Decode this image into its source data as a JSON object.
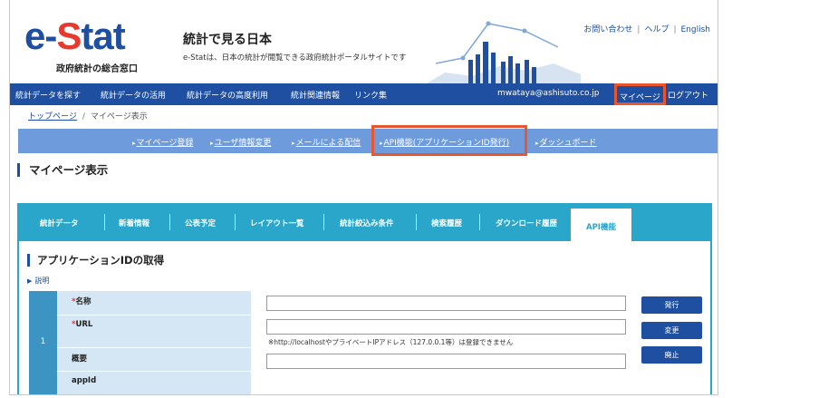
{
  "header": {
    "logo": {
      "e": "e",
      "dash": "-",
      "S": "S",
      "tat": "tat"
    },
    "logo_sub": "政府統計の総合窓口",
    "title": "統計で見る日本",
    "desc": "e-Statは、日本の統計が閲覧できる政府統計ポータルサイトです",
    "links": [
      "お問い合わせ",
      "ヘルプ",
      "English"
    ],
    "link_sep": "|"
  },
  "nav": {
    "items": [
      "統計データを探す",
      "統計データの活用",
      "統計データの高度利用",
      "統計関連情報",
      "リンク集"
    ],
    "user": "mwataya@ashisuto.co.jp",
    "mypage": "マイページ",
    "logout": "ログアウト"
  },
  "breadcrumb": {
    "home": "トップページ",
    "sep": "/",
    "current": "マイページ表示"
  },
  "submenu": [
    "マイページ登録",
    "ユーザ情報変更",
    "メールによる配信",
    "API機能(アプリケーションID発行)",
    "ダッシュボード"
  ],
  "page_title": "マイページ表示",
  "tabs": [
    "統計データ",
    "新着情報",
    "公表予定",
    "レイアウト一覧",
    "統計絞込み条件",
    "検索履歴",
    "ダウンロード履歴"
  ],
  "active_tab": "API機能",
  "section": {
    "title": "アプリケーションIDの取得",
    "explain": "説明"
  },
  "form": {
    "row_number": "1",
    "required_mark": "*",
    "fields": {
      "name": {
        "label": "名称",
        "value": ""
      },
      "url": {
        "label": "URL",
        "value": "",
        "note": "※http://localhostやプライベートIPアドレス（127.0.0.1等）は登録できません"
      },
      "summary": {
        "label": "概要",
        "value": ""
      },
      "appid": {
        "label": "appId",
        "value": ""
      }
    },
    "buttons": {
      "issue": "発行",
      "change": "変更",
      "abolish": "廃止"
    }
  },
  "colors": {
    "brand_blue": "#1e4fa0",
    "logo_red": "#e63a2e",
    "highlight": "#e8552e",
    "tab_teal": "#29a6c9",
    "submenu_blue": "#6e9bdc",
    "label_bg": "#d5e6f4"
  }
}
